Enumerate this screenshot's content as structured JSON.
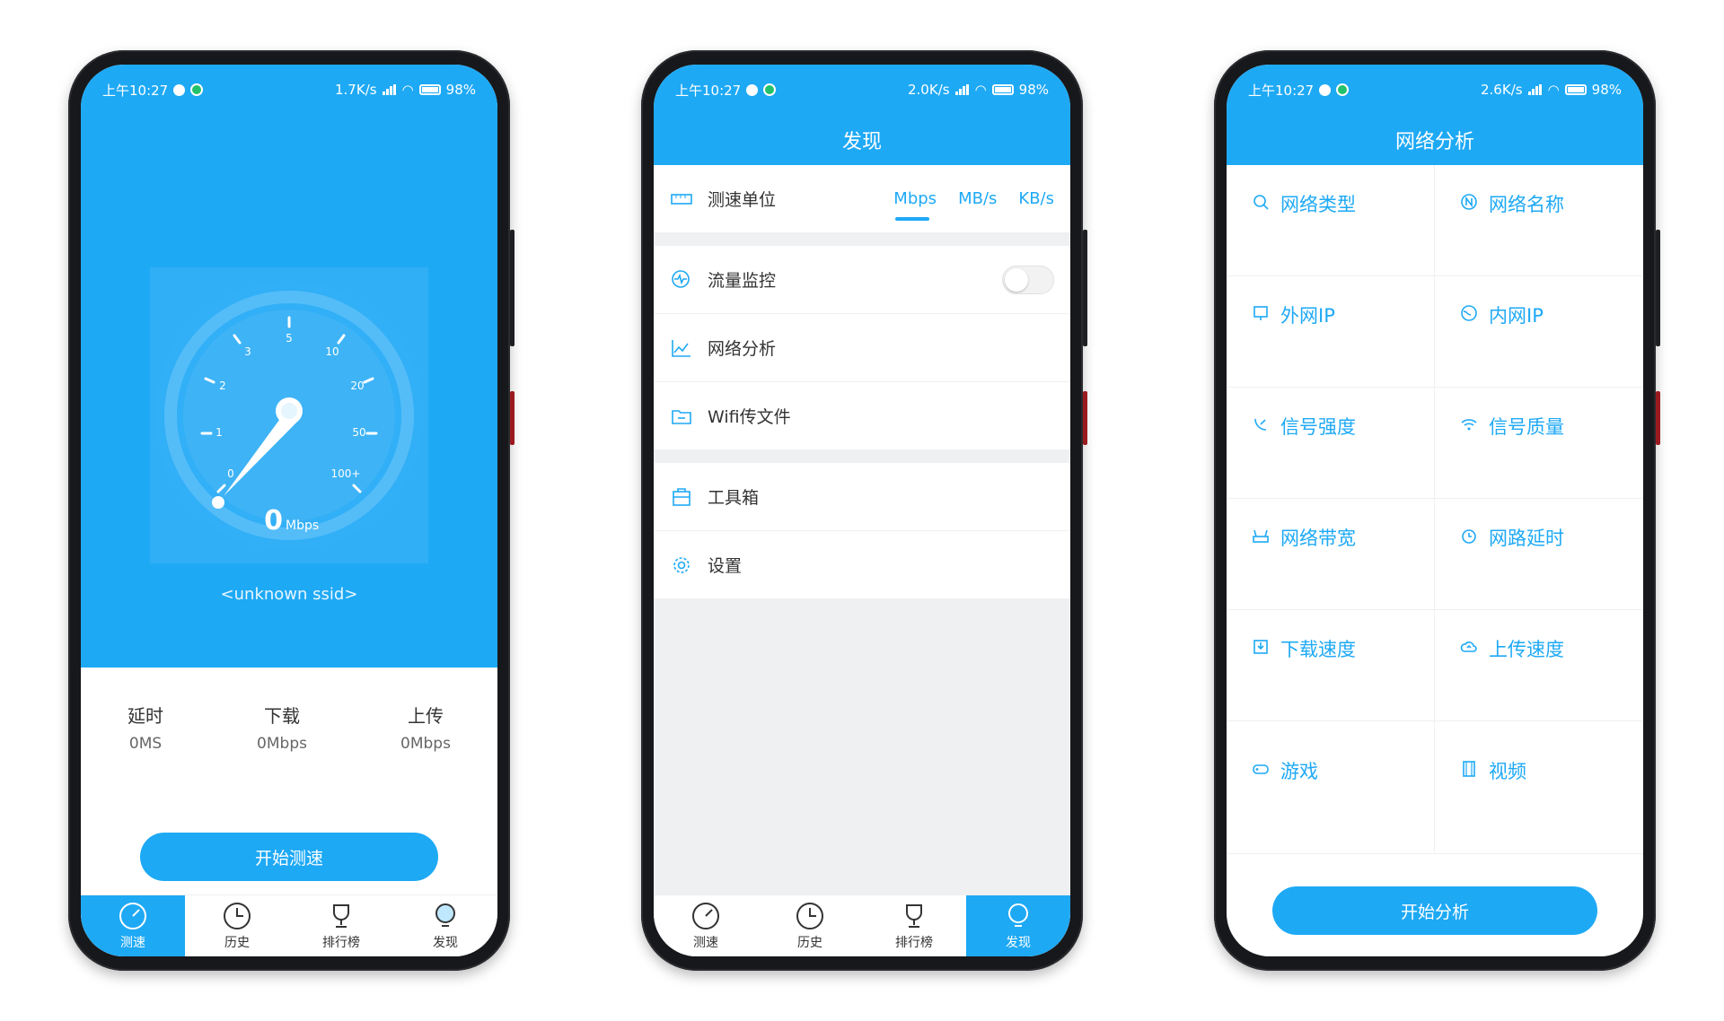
{
  "status": [
    {
      "time": "上午10:27",
      "speed": "1.7K/s",
      "battery": "98"
    },
    {
      "time": "上午10:27",
      "speed": "2.0K/s",
      "battery": "98"
    },
    {
      "time": "上午10:27",
      "speed": "2.6K/s",
      "battery": "98"
    }
  ],
  "speedtest": {
    "gauge_ticks": [
      "0",
      "1",
      "2",
      "3",
      "5",
      "10",
      "20",
      "50",
      "100+"
    ],
    "value": "0",
    "unit": "Mbps",
    "ssid": "<unknown ssid>",
    "metrics": [
      {
        "label": "延时",
        "value": "0MS"
      },
      {
        "label": "下载",
        "value": "0Mbps"
      },
      {
        "label": "上传",
        "value": "0Mbps"
      }
    ],
    "start_button": "开始测速"
  },
  "tabs": [
    "测速",
    "历史",
    "排行榜",
    "发现"
  ],
  "discover": {
    "title": "发现",
    "unit_row": {
      "label": "测速单位",
      "options": [
        "Mbps",
        "MB/s",
        "KB/s"
      ],
      "selected": "Mbps"
    },
    "items_group1": [
      "流量监控",
      "网络分析",
      "Wifi传文件"
    ],
    "items_group2": [
      "工具箱",
      "设置"
    ]
  },
  "analysis": {
    "title": "网络分析",
    "cells": [
      "网络类型",
      "网络名称",
      "外网IP",
      "内网IP",
      "信号强度",
      "信号质量",
      "网络带宽",
      "网路延时",
      "下载速度",
      "上传速度",
      "游戏",
      "视频"
    ],
    "start_button": "开始分析"
  },
  "colors": {
    "primary": "#1ea9f5"
  }
}
